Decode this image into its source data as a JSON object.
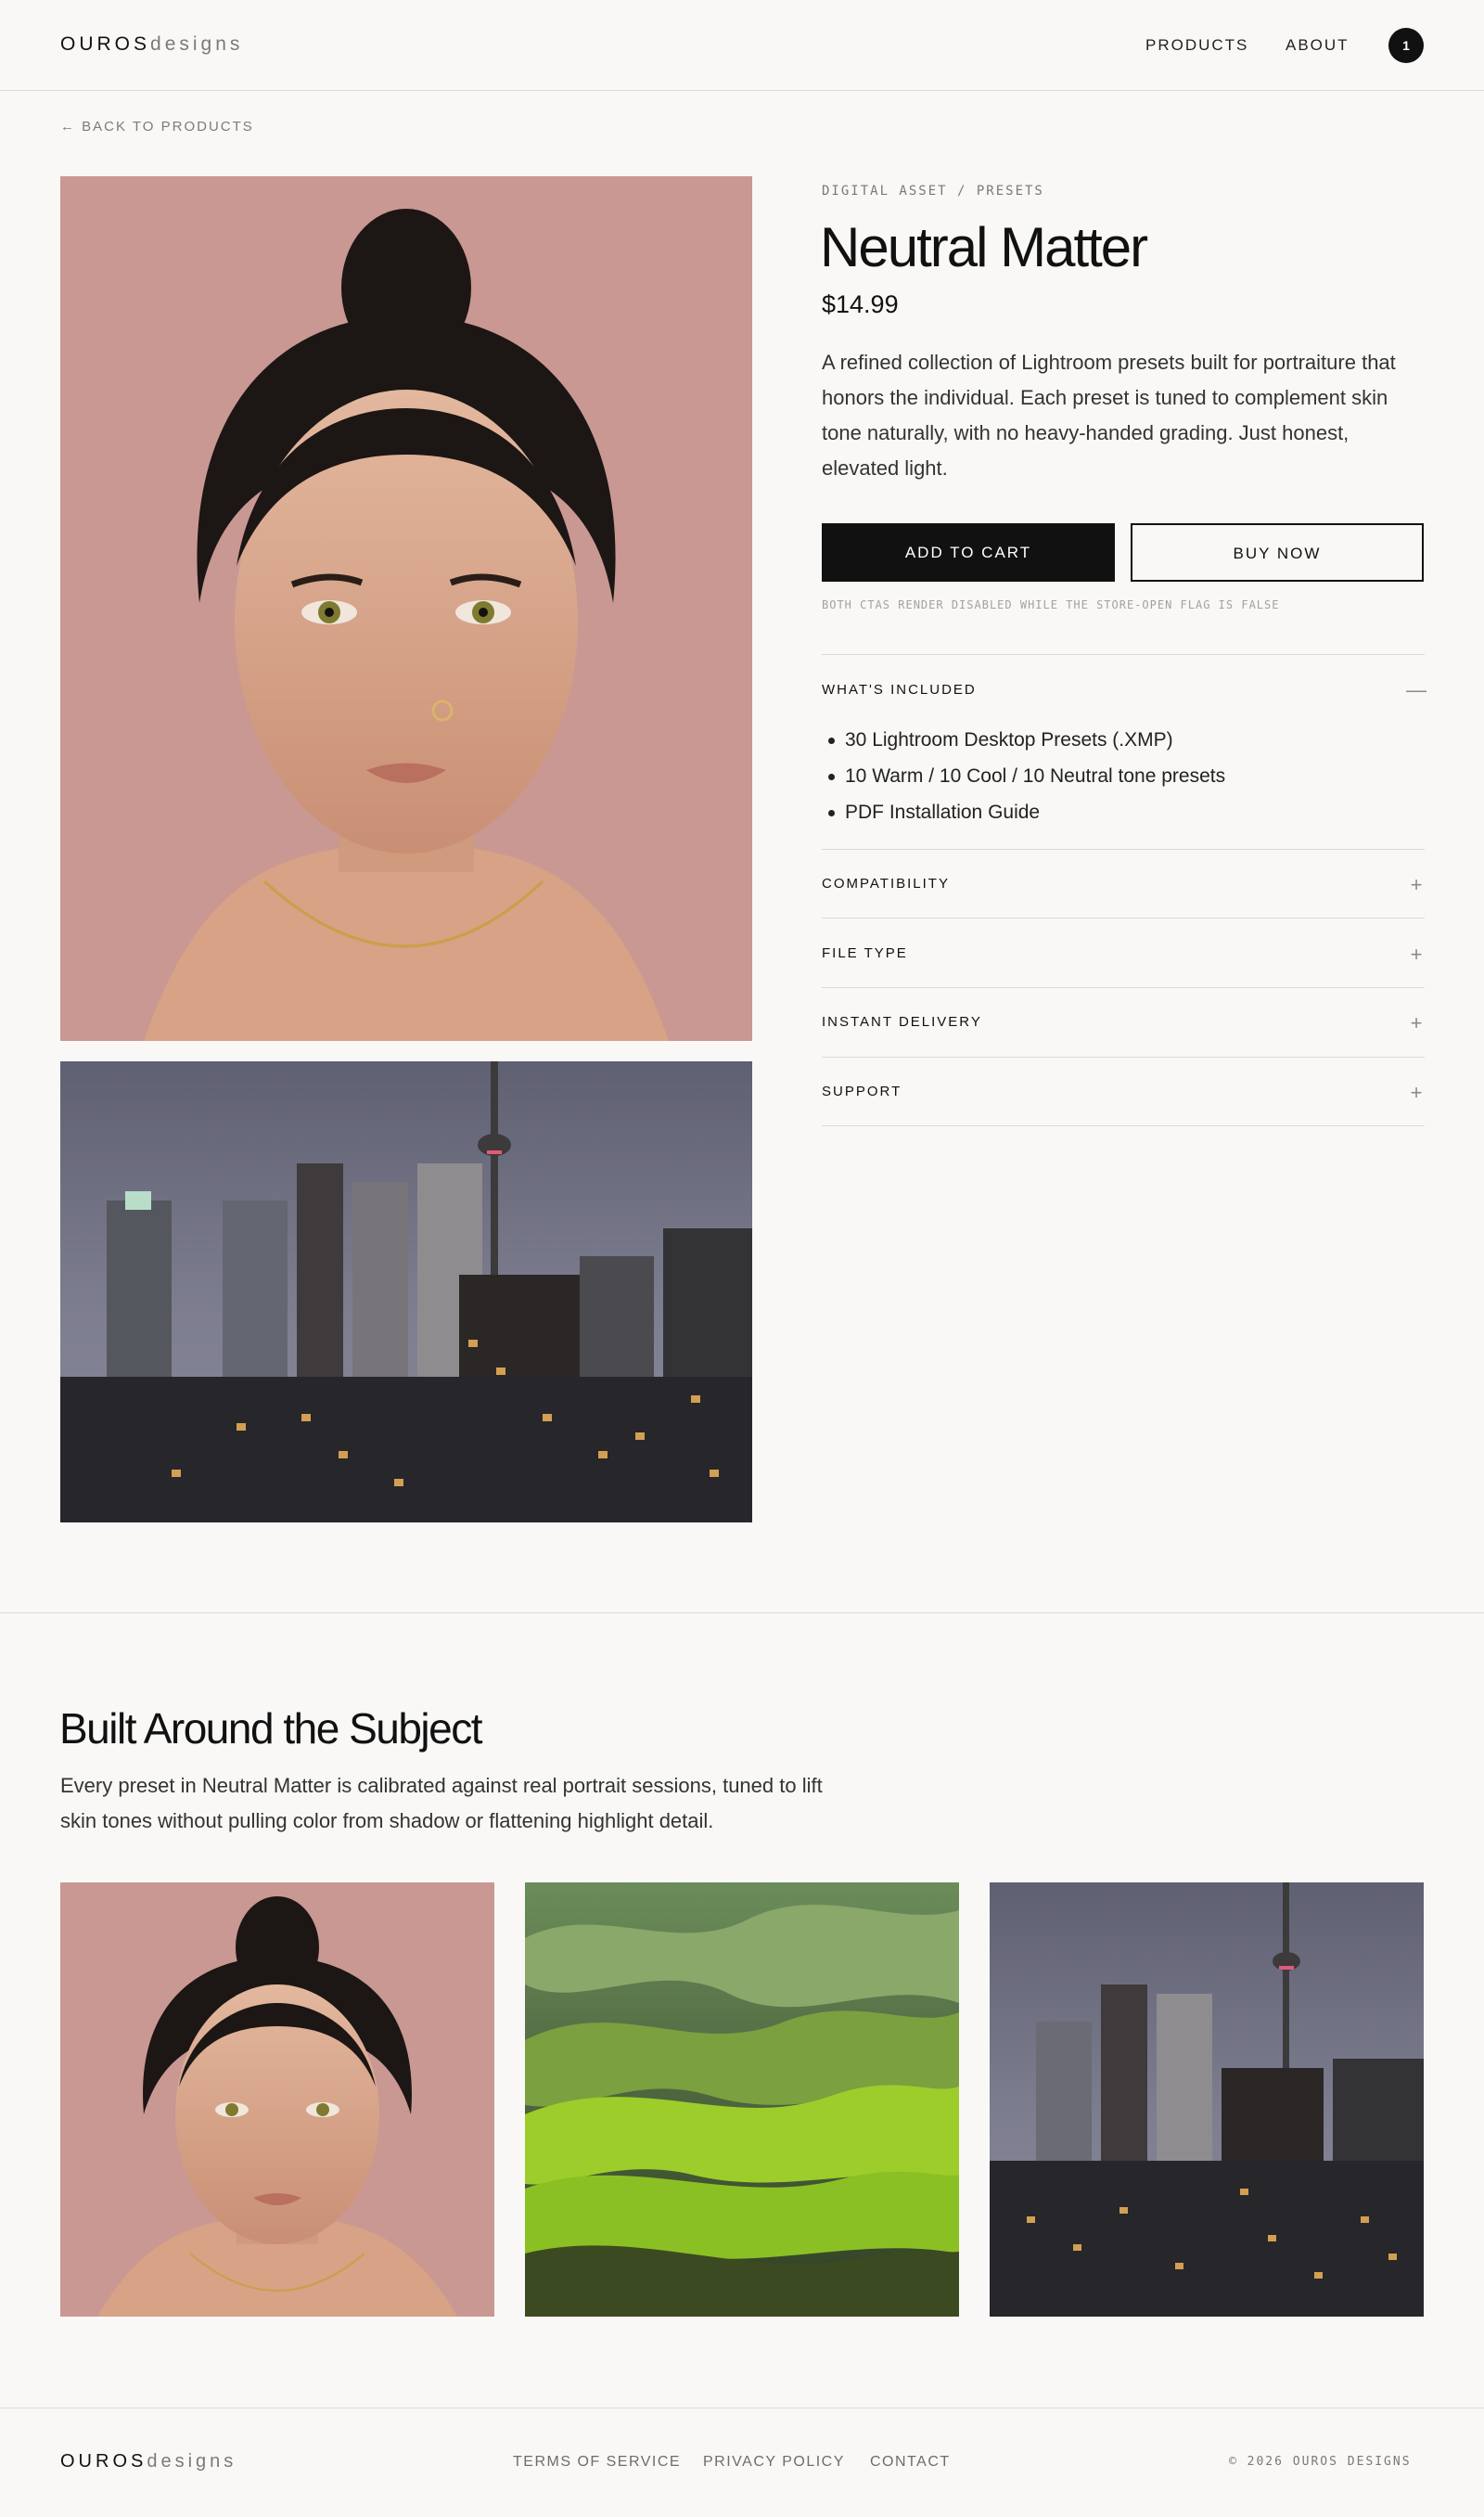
{
  "header": {
    "brand_primary": "OUROS",
    "brand_secondary": "designs",
    "nav": [
      "PRODUCTS",
      "ABOUT"
    ],
    "cart_count": "1"
  },
  "back_link": "← BACK TO PRODUCTS",
  "product": {
    "eyebrow": "DIGITAL ASSET / PRESETS",
    "title": "Neutral Matter",
    "price": "$14.99",
    "description": "A refined collection of Lightroom presets built for portraiture that honors the individual. Each preset is tuned to complement skin tone naturally, with no heavy-handed grading. Just honest, elevated light.",
    "add_to_cart_label": "ADD TO CART",
    "buy_now_label": "BUY NOW",
    "cta_note": "BOTH CTAS RENDER DISABLED WHILE THE STORE-OPEN FLAG IS FALSE"
  },
  "accordion": [
    {
      "label": "WHAT'S INCLUDED",
      "sign": "—",
      "items": [
        "30 Lightroom Desktop Presets (.XMP)",
        "10 Warm / 10 Cool / 10 Neutral tone presets",
        "PDF Installation Guide"
      ]
    },
    {
      "label": "COMPATIBILITY",
      "sign": "+"
    },
    {
      "label": "FILE TYPE",
      "sign": "+"
    },
    {
      "label": "INSTANT DELIVERY",
      "sign": "+"
    },
    {
      "label": "SUPPORT",
      "sign": "+"
    }
  ],
  "section": {
    "title": "Built Around the Subject",
    "description": "Every preset in Neutral Matter is calibrated against real portrait sessions, tuned to lift skin tones without pulling color from shadow or flattening highlight detail."
  },
  "images": {
    "hero_portrait": "portrait-photo",
    "hero_city": "city-skyline-photo",
    "tiles": [
      "portrait-photo",
      "green-hills-photo",
      "city-skyline-photo"
    ]
  },
  "footer": {
    "brand_primary": "OUROS",
    "brand_secondary": "designs",
    "links": [
      "TERMS OF SERVICE",
      "PRIVACY POLICY",
      "CONTACT"
    ],
    "copyright": "© 2026 OUROS DESIGNS"
  },
  "colors": {
    "background": "#f9f8f6",
    "ink": "#111111",
    "muted": "#7a7976",
    "divider": "#dcdad5",
    "portrait_bg": "#c99892"
  }
}
